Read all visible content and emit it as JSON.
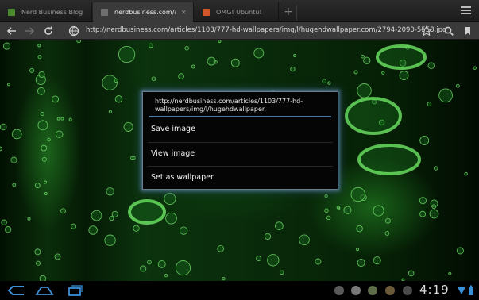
{
  "tabs": [
    {
      "label": "Nerd Business Blog",
      "favicon_color": "#4c8a2e",
      "active": false
    },
    {
      "label": "nerdbusiness.com/artic...",
      "favicon_color": "#6f6f6f",
      "active": true
    },
    {
      "label": "OMG! Ubuntu!",
      "favicon_color": "#d2572a",
      "active": false
    }
  ],
  "tab_close_glyph": "×",
  "new_tab_glyph": "+",
  "url": "http://nerdbusiness.com/articles/1103/777-hd-wallpapers/img/l/hugehdwallpaper.com/2794-2090-5558.jpg",
  "dialog": {
    "title": "http://nerdbusiness.com/articles/1103/777-hd-wallpapers/img/l/hugehdwallpaper.",
    "items": [
      "Save image",
      "View image",
      "Set as wallpaper"
    ]
  },
  "status": {
    "time": "4:19"
  },
  "colors": {
    "accent": "#4a7aa8",
    "background_green": "#0b330d"
  }
}
